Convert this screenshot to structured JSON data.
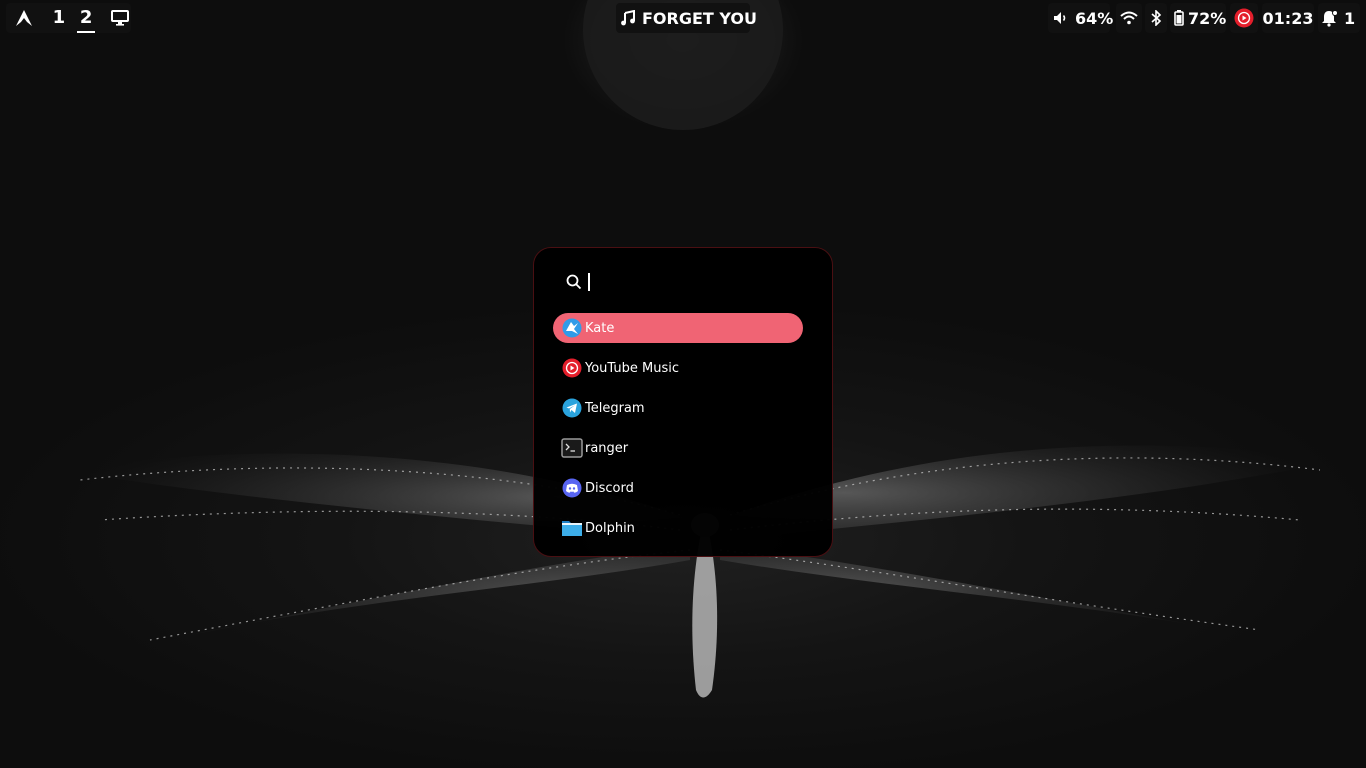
{
  "top_bar": {
    "launcher_icon": "arch-logo-icon",
    "workspaces": [
      {
        "label": "1",
        "active": false
      },
      {
        "label": "2",
        "active": true
      }
    ],
    "display_icon": "monitor-icon",
    "now_playing": {
      "icon": "music-note-icon",
      "title": "FORGET YOU"
    },
    "volume": {
      "icon": "speaker-icon",
      "value": "64%"
    },
    "wifi_icon": "wifi-icon",
    "bluetooth_icon": "bluetooth-icon",
    "battery": {
      "icon": "battery-icon",
      "value": "72%"
    },
    "media_app_icon": "youtube-music-icon",
    "clock": "01:23",
    "notifications": {
      "icon": "bell-icon",
      "count": "1"
    }
  },
  "launcher": {
    "search": {
      "icon": "search-icon",
      "value": ""
    },
    "apps": [
      {
        "label": "Kate",
        "icon": "kate-icon",
        "selected": true
      },
      {
        "label": "YouTube Music",
        "icon": "youtube-music-icon",
        "selected": false
      },
      {
        "label": "Telegram",
        "icon": "telegram-icon",
        "selected": false
      },
      {
        "label": "ranger",
        "icon": "terminal-icon",
        "selected": false
      },
      {
        "label": "Discord",
        "icon": "discord-icon",
        "selected": false
      },
      {
        "label": "Dolphin",
        "icon": "folder-icon",
        "selected": false
      }
    ]
  },
  "colors": {
    "accent": "#f06474",
    "bar_pill": "#111111",
    "launcher_border": "#4a0f12",
    "youtube_red": "#e41e2b"
  }
}
